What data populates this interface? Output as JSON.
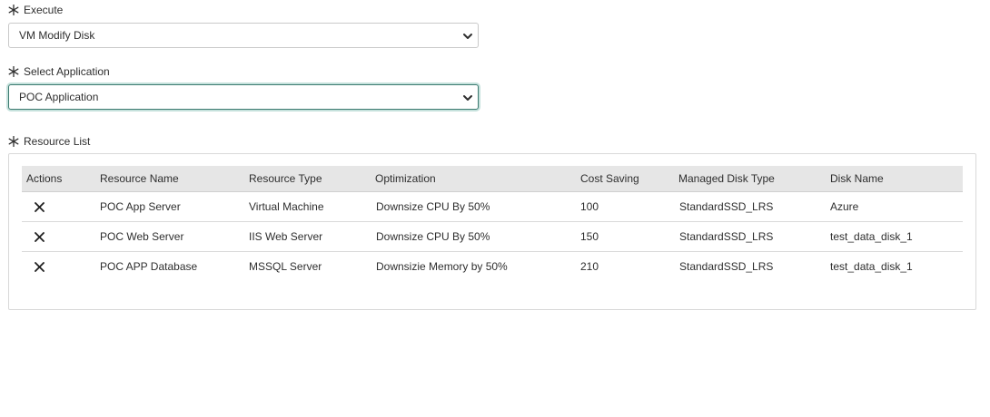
{
  "execute": {
    "label": "Execute",
    "selected": "VM Modify Disk"
  },
  "application": {
    "label": "Select Application",
    "selected": "POC Application"
  },
  "resources": {
    "label": "Resource List",
    "headers": [
      "Actions",
      "Resource Name",
      "Resource Type",
      "Optimization",
      "Cost Saving",
      "Managed Disk Type",
      "Disk Name"
    ],
    "rows": [
      {
        "name": "POC App Server",
        "type": "Virtual Machine",
        "optimization": "Downsize CPU By 50%",
        "cost": "100",
        "disk_type": "StandardSSD_LRS",
        "disk_name": "Azure"
      },
      {
        "name": "POC Web Server",
        "type": "IIS Web Server",
        "optimization": "Downsize CPU By 50%",
        "cost": "150",
        "disk_type": "StandardSSD_LRS",
        "disk_name": "test_data_disk_1"
      },
      {
        "name": "POC APP Database",
        "type": "MSSQL Server",
        "optimization": "Downsizie Memory by 50%",
        "cost": "210",
        "disk_type": "StandardSSD_LRS",
        "disk_name": "test_data_disk_1"
      }
    ]
  },
  "icons": {
    "required": "asterisk-icon",
    "dropdown": "chevron-down-icon",
    "remove": "close-icon"
  },
  "colors": {
    "focus_border": "#3c7a70",
    "header_bg": "#e6e6e6"
  }
}
